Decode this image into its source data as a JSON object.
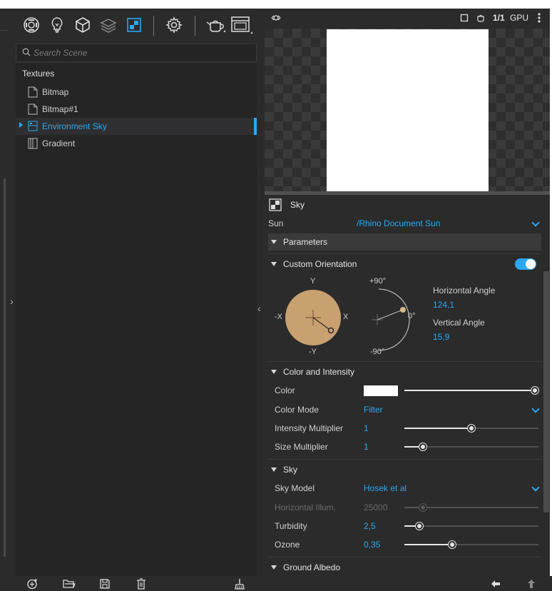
{
  "colors": {
    "accent": "#2aa8f2",
    "panel_bg": "#2b2b2b",
    "tree_bg": "#252526",
    "sun_disc": "#c9a070",
    "text": "#d8d8d8"
  },
  "toolbar": {
    "icons": [
      "materials-icon",
      "lights-icon",
      "environments-icon",
      "ground-plane-icon",
      "textures-icon",
      "settings-icon",
      "teapot-icon",
      "window-icon"
    ]
  },
  "search": {
    "placeholder": "Search Scene"
  },
  "tree": {
    "heading": "Textures",
    "items": [
      {
        "label": "Bitmap",
        "icon": "bitmap-icon",
        "selected": false
      },
      {
        "label": "Bitmap#1",
        "icon": "bitmap-icon",
        "selected": false
      },
      {
        "label": "Environment Sky",
        "icon": "sky-texture-icon",
        "selected": true
      },
      {
        "label": "Gradient",
        "icon": "gradient-icon",
        "selected": false
      }
    ]
  },
  "preview_bar": {
    "scale": "1/1",
    "engine": "GPU"
  },
  "props": {
    "title": "Sky",
    "sun": {
      "label": "Sun",
      "value": "/Rhino Document Sun"
    },
    "parameters": {
      "label": "Parameters"
    },
    "orientation": {
      "label": "Custom Orientation",
      "enabled": true,
      "compass": {
        "top": "Y",
        "bottom": "-Y",
        "left": "-X",
        "right": "X"
      },
      "elevation": {
        "top": "+90°",
        "middle": "0°",
        "bottom": "-90°"
      },
      "horizontal": {
        "label": "Horizontal Angle",
        "value": "124,1"
      },
      "vertical": {
        "label": "Vertical Angle",
        "value": "15,9"
      }
    },
    "color_intensity": {
      "label": "Color and Intensity",
      "color": {
        "label": "Color",
        "swatch": "#ffffff",
        "slider": 1.0
      },
      "color_mode": {
        "label": "Color Mode",
        "value": "Filter"
      },
      "intensity": {
        "label": "Intensity Multiplier",
        "value": "1",
        "slider": 0.5
      },
      "size": {
        "label": "Size Multiplier",
        "value": "1",
        "slider": 0.12
      }
    },
    "sky": {
      "label": "Sky",
      "model": {
        "label": "Sky Model",
        "value": "Hosek et al"
      },
      "horizontal_illum": {
        "label": "Horizontal Illum.",
        "value": "25000",
        "slider": 0.12,
        "disabled": true
      },
      "turbidity": {
        "label": "Turbidity",
        "value": "2,5",
        "slider": 0.09
      },
      "ozone": {
        "label": "Ozone",
        "value": "0,35",
        "slider": 0.35
      }
    },
    "ground_albedo": {
      "label": "Ground Albedo"
    }
  },
  "bottombar": {
    "icons": [
      "add-icon",
      "open-folder-icon",
      "save-icon",
      "delete-icon",
      "broom-icon",
      "back-arrow-icon",
      "up-arrow-icon"
    ]
  }
}
